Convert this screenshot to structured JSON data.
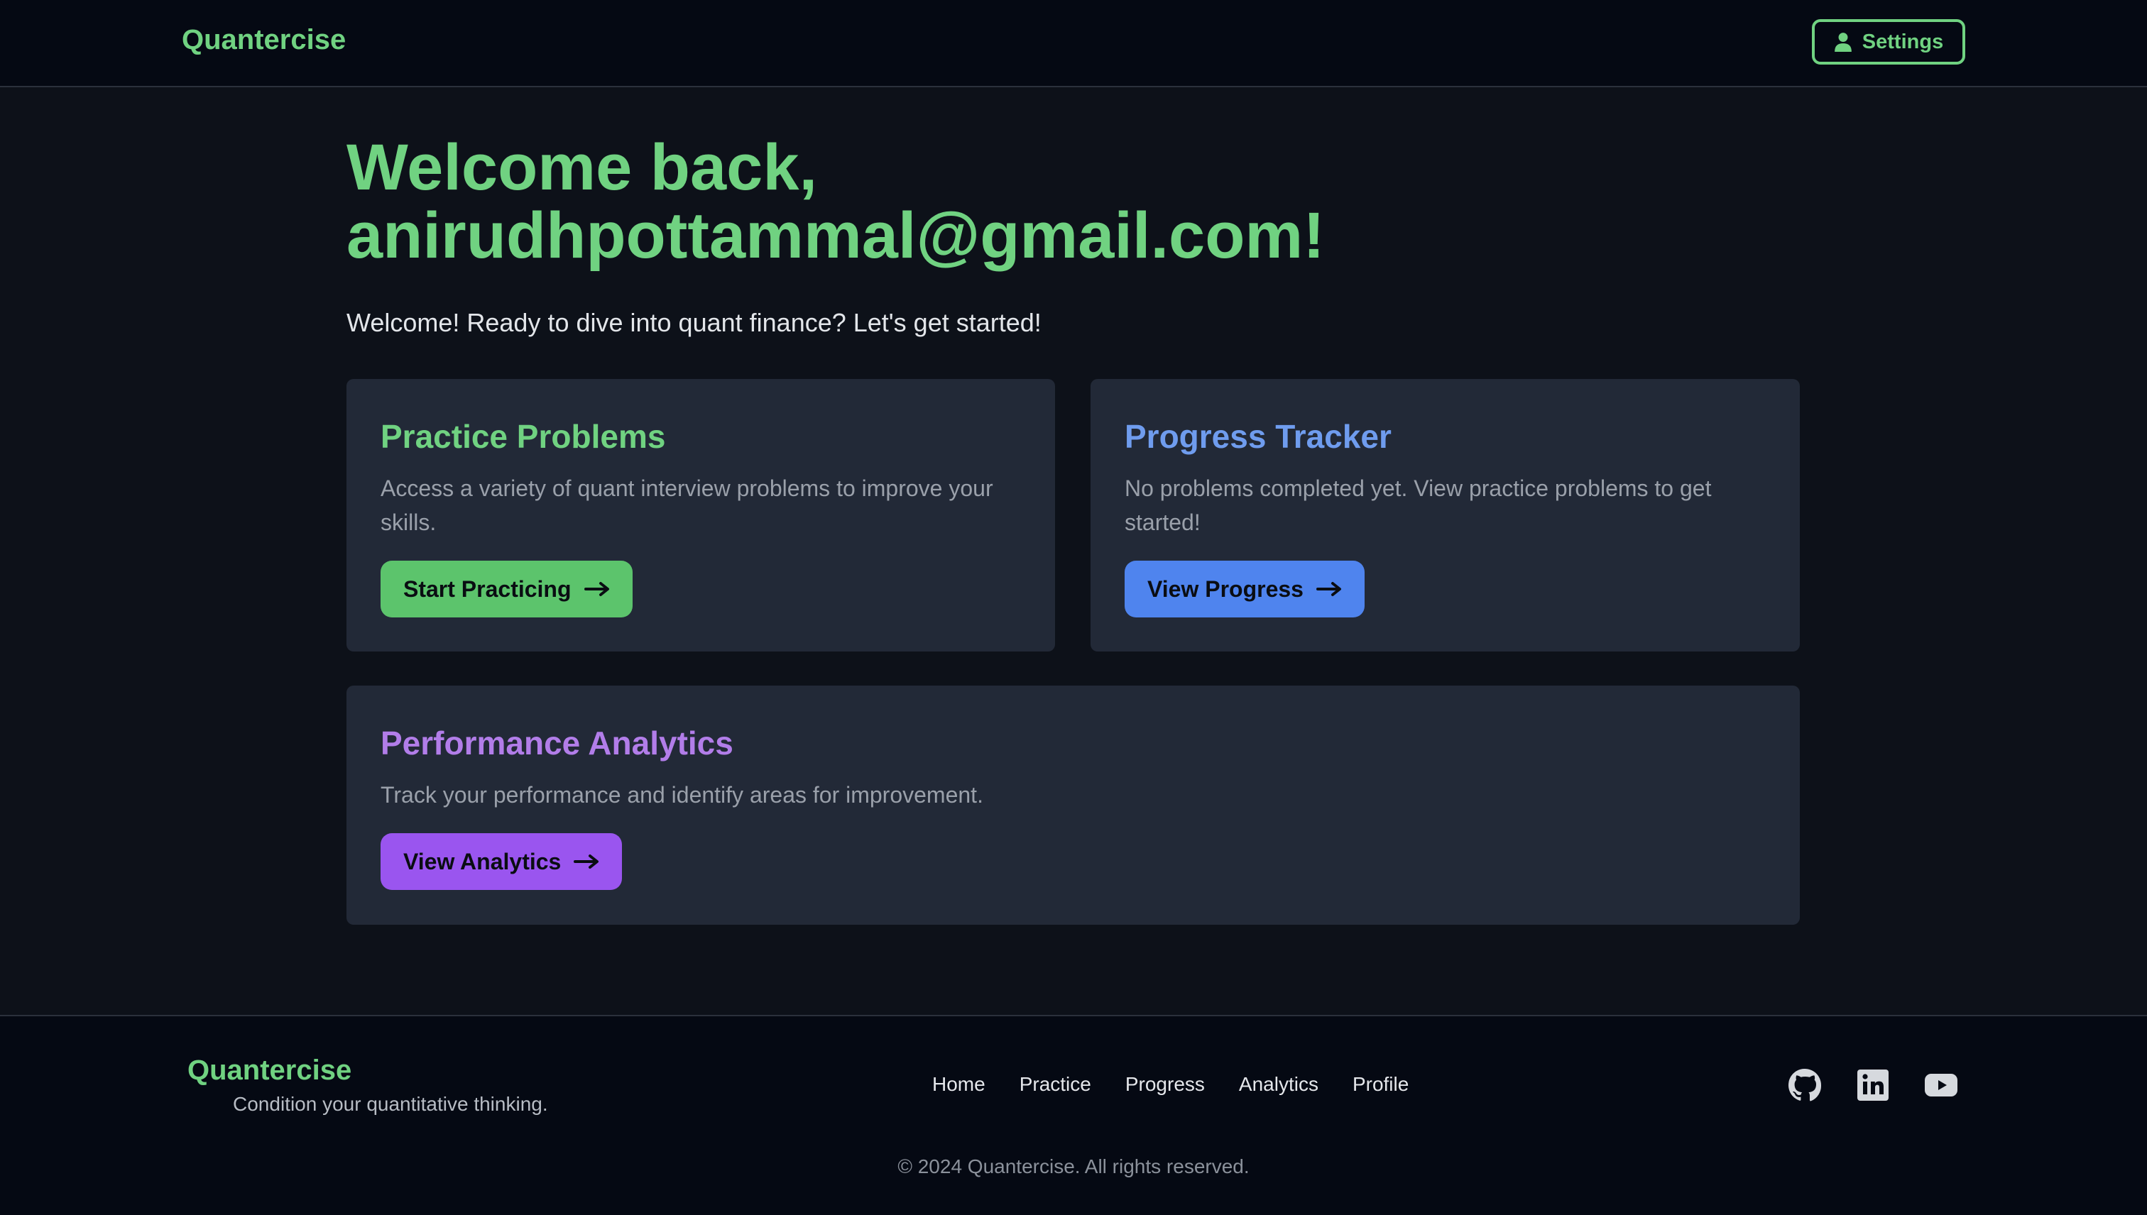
{
  "header": {
    "brand": "Quantercise",
    "settings_label": "Settings"
  },
  "main": {
    "welcome_line1": "Welcome back,",
    "welcome_line2": "anirudhpottammal@gmail.com!",
    "subtitle": "Welcome! Ready to dive into quant finance? Let's get started!"
  },
  "cards": {
    "practice": {
      "title": "Practice Problems",
      "description": "Access a variety of quant interview problems to improve your skills.",
      "button": "Start Practicing",
      "accent": "#70d281",
      "button_bg": "#5cc46c"
    },
    "progress": {
      "title": "Progress Tracker",
      "description": "No problems completed yet. View practice problems to get started!",
      "button": "View Progress",
      "accent": "#6f9cee",
      "button_bg": "#4f84ee"
    },
    "analytics": {
      "title": "Performance Analytics",
      "description": "Track your performance and identify areas for improvement.",
      "button": "View Analytics",
      "accent": "#b27de9",
      "button_bg": "#9a55ef"
    }
  },
  "footer": {
    "brand": "Quantercise",
    "tagline": "Condition your quantitative thinking.",
    "nav": [
      "Home",
      "Practice",
      "Progress",
      "Analytics",
      "Profile"
    ],
    "socials": [
      "github-icon",
      "linkedin-icon",
      "youtube-icon"
    ],
    "copyright": "© 2024 Quantercise. All rights reserved."
  }
}
